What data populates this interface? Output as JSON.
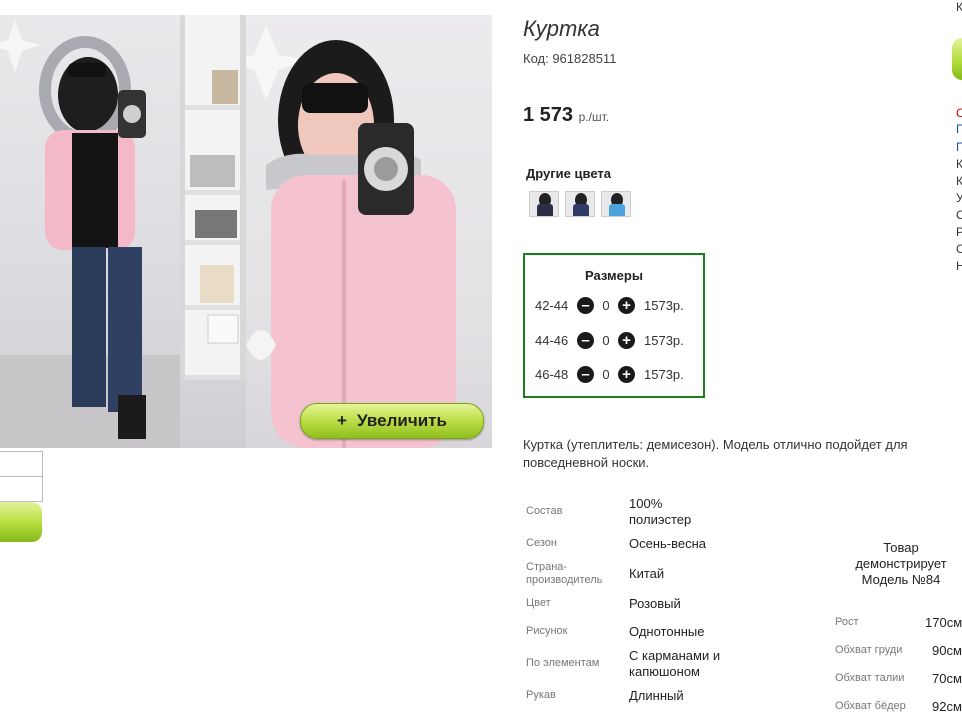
{
  "product": {
    "title": "Куртка",
    "code": "Код: 961828511",
    "price": "1 573",
    "price_unit": "р./шт."
  },
  "gallery": {
    "zoom_label": "Увеличить",
    "zoom_icon": "+"
  },
  "other_colors": {
    "heading": "Другие цвета",
    "swatches": [
      {
        "name": "color-swatch-dark",
        "color": "#2b2f45"
      },
      {
        "name": "color-swatch-navy",
        "color": "#303a66"
      },
      {
        "name": "color-swatch-blue",
        "color": "#4aa3dc"
      }
    ]
  },
  "sizes": {
    "heading": "Размеры",
    "rows": [
      {
        "size": "42-44",
        "qty": "0",
        "price": "1573р."
      },
      {
        "size": "44-46",
        "qty": "0",
        "price": "1573р."
      },
      {
        "size": "46-48",
        "qty": "0",
        "price": "1573р."
      }
    ]
  },
  "description": "Куртка (утеплитель: демисезон). Модель отлично подойдет для повседневной носки.",
  "specs": [
    {
      "label": "Состав",
      "value": "100% полиэстер"
    },
    {
      "label": "Сезон",
      "value": "Осень-весна"
    },
    {
      "label": "Страна-производитель",
      "value": "Китай"
    },
    {
      "label": "Цвет",
      "value": "Розовый"
    },
    {
      "label": "Рисунок",
      "value": "Однотонные"
    },
    {
      "label": "По элементам",
      "value": "С карманами и капюшоном"
    },
    {
      "label": "Рукав",
      "value": "Длинный"
    }
  ],
  "model": {
    "heading": "Товар демонстрирует Модель №84",
    "params": [
      {
        "label": "Рост",
        "value": "170см"
      },
      {
        "label": "Обхват груди",
        "value": "90см"
      },
      {
        "label": "Обхват талии",
        "value": "70см"
      },
      {
        "label": "Обхват бёдер",
        "value": "92см"
      }
    ]
  },
  "right_edge": [
    "К",
    "С",
    "П",
    "П",
    "К",
    "К",
    "У",
    "С",
    "Р",
    "С",
    "Н"
  ],
  "colors": {
    "accent_green": "#1c7d1c",
    "button_green": "#b3dc3c",
    "jacket_pink": "#f4c3cf"
  }
}
